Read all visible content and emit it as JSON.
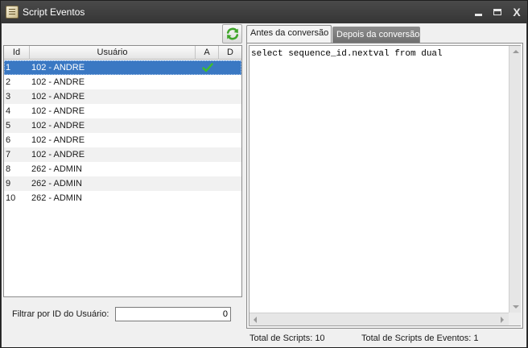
{
  "window": {
    "title": "Script Eventos",
    "icons": {
      "app": "script-app-icon",
      "minimize": "minimize-icon",
      "maximize": "maximize-icon",
      "close": "close-icon"
    },
    "close_label": "X"
  },
  "grid": {
    "columns": {
      "id": "Id",
      "user": "Usuário",
      "a": "A",
      "d": "D"
    },
    "rows": [
      {
        "id": "1",
        "user": "102 - ANDRE",
        "a_checked": true
      },
      {
        "id": "2",
        "user": "102 - ANDRE",
        "a_checked": false
      },
      {
        "id": "3",
        "user": "102 - ANDRE",
        "a_checked": false
      },
      {
        "id": "4",
        "user": "102 - ANDRE",
        "a_checked": false
      },
      {
        "id": "5",
        "user": "102 - ANDRE",
        "a_checked": false
      },
      {
        "id": "6",
        "user": "102 - ANDRE",
        "a_checked": false
      },
      {
        "id": "7",
        "user": "102 - ANDRE",
        "a_checked": false
      },
      {
        "id": "8",
        "user": "262 - ADMIN",
        "a_checked": false
      },
      {
        "id": "9",
        "user": "262 - ADMIN",
        "a_checked": false
      },
      {
        "id": "10",
        "user": "262 - ADMIN",
        "a_checked": false
      }
    ],
    "selected_row": "1",
    "refresh_icon": "refresh-icon",
    "check_icon": "checkmark-icon"
  },
  "filter": {
    "label": "Filtrar por ID do Usuário:",
    "value": "0"
  },
  "tabs": {
    "before": "Antes da conversão",
    "after": "Depois da conversão",
    "active": "before"
  },
  "editor": {
    "content": "select sequence_id.nextval from dual"
  },
  "status": {
    "total_scripts": "Total de Scripts: 10",
    "total_event_scripts": "Total de Scripts de Eventos: 1"
  },
  "colors": {
    "selection": "#3a78c3",
    "check": "#3fbf2a",
    "refresh": "#3fa52a"
  }
}
